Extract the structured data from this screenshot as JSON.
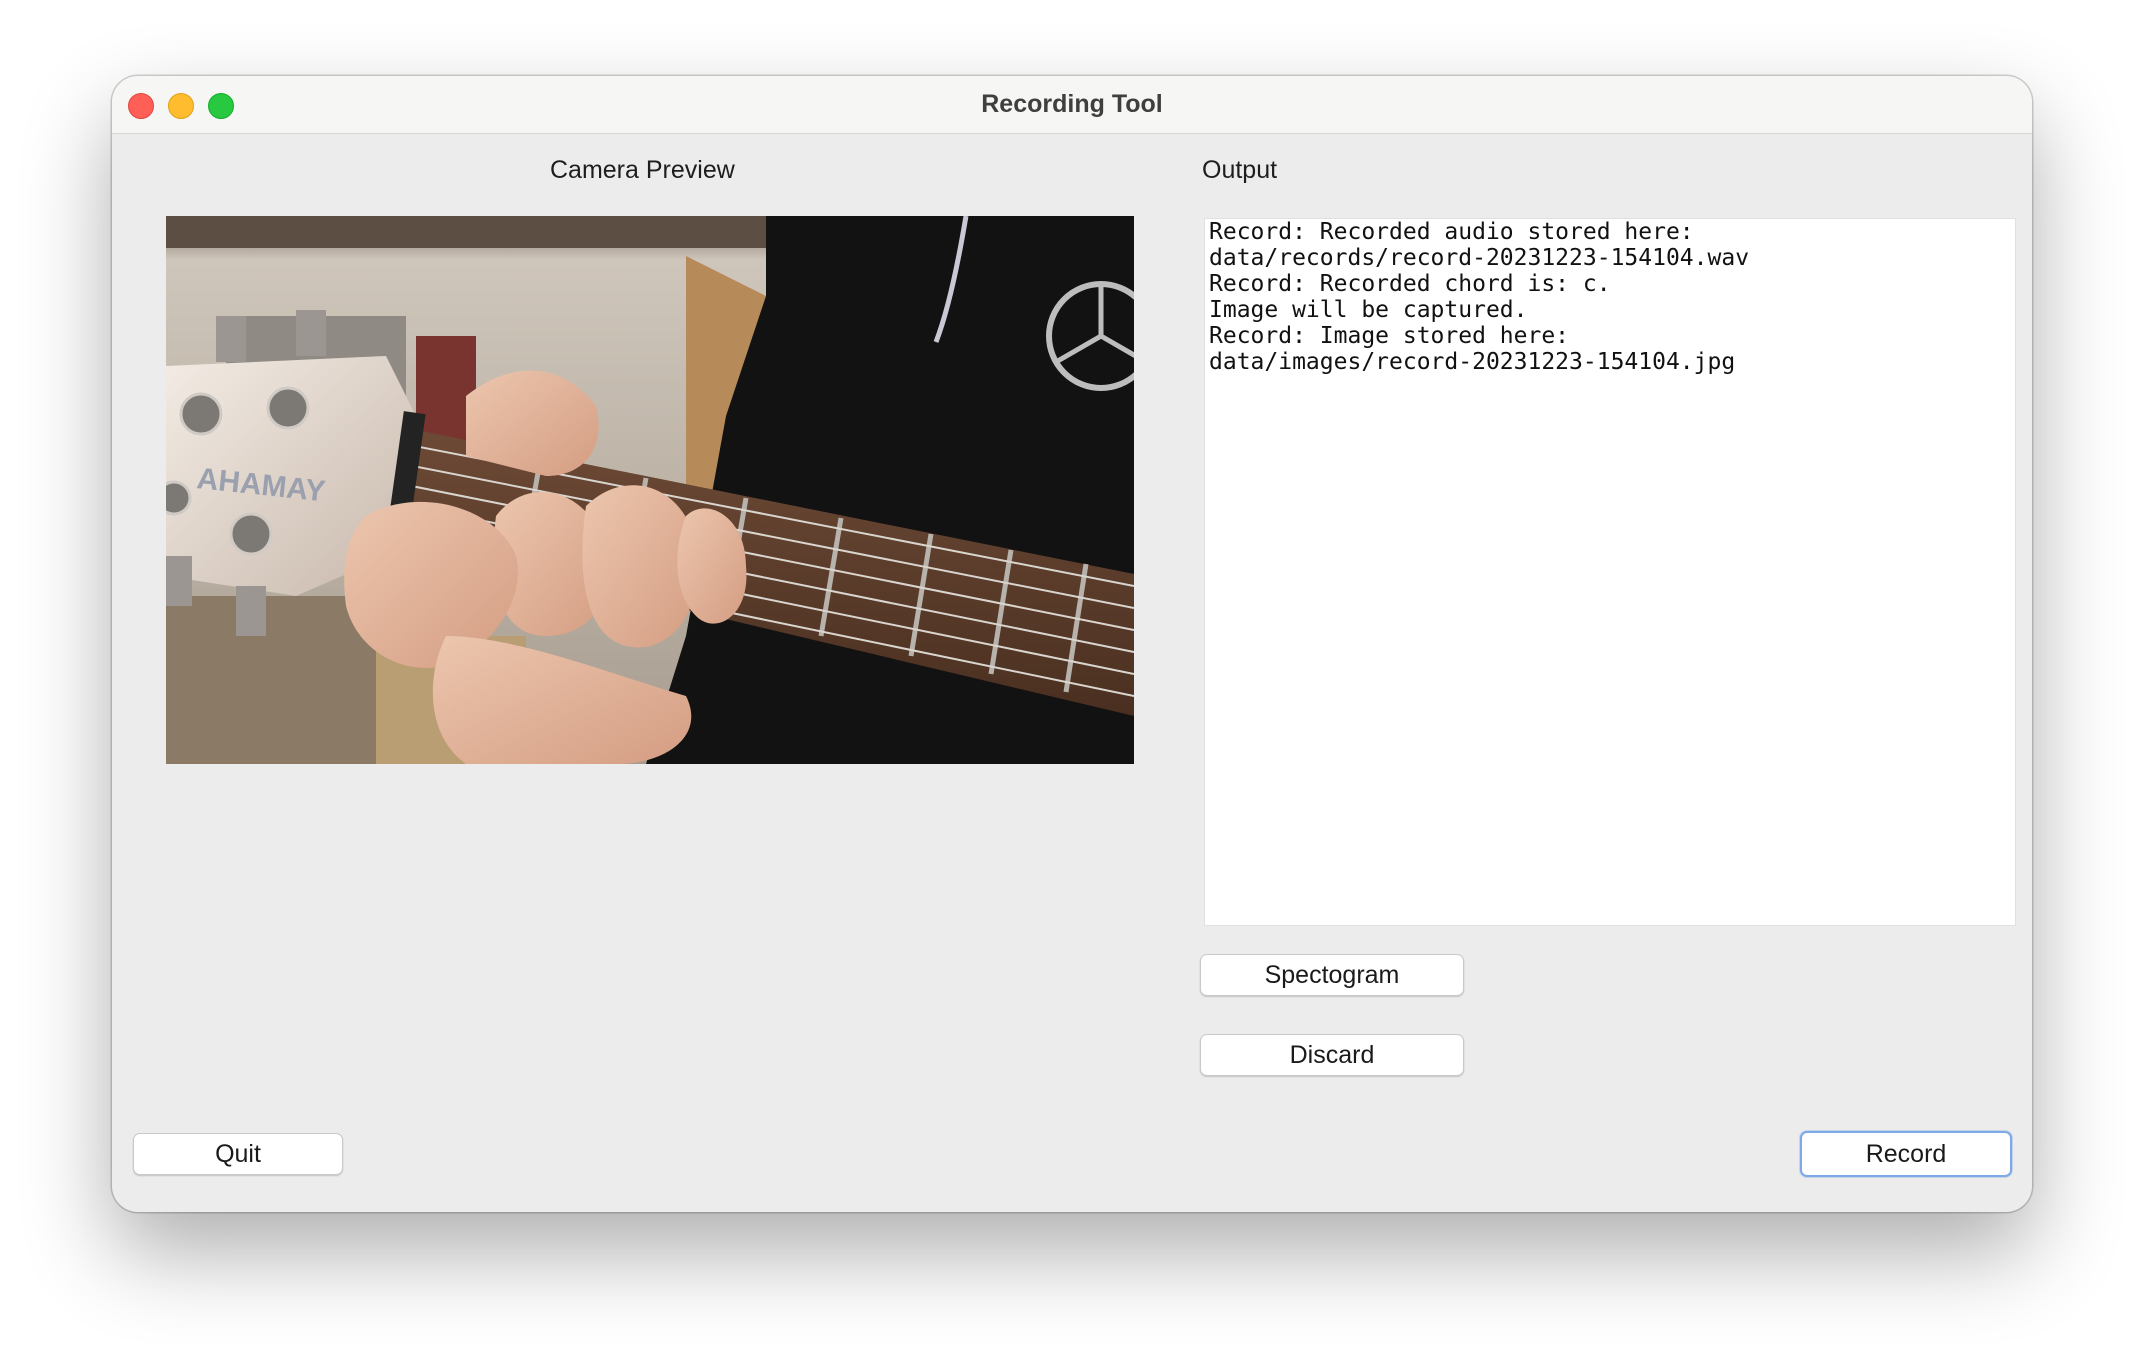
{
  "window": {
    "title": "Recording Tool"
  },
  "camera": {
    "label": "Camera Preview",
    "brand_text": "AHAMAY"
  },
  "output": {
    "label": "Output",
    "lines": [
      "Record: Recorded audio stored here:",
      "data/records/record-20231223-154104.wav",
      "Record: Recorded chord is: c.",
      "Image will be captured.",
      "Record: Image stored here:",
      "data/images/record-20231223-154104.jpg"
    ]
  },
  "buttons": {
    "spectogram": "Spectogram",
    "discard": "Discard",
    "quit": "Quit",
    "record": "Record"
  },
  "colors": {
    "window_bg": "#ececec",
    "focus_ring": "#7ea9e6",
    "close": "#ff5f57",
    "minimize": "#febc2e",
    "maximize": "#28c840"
  }
}
